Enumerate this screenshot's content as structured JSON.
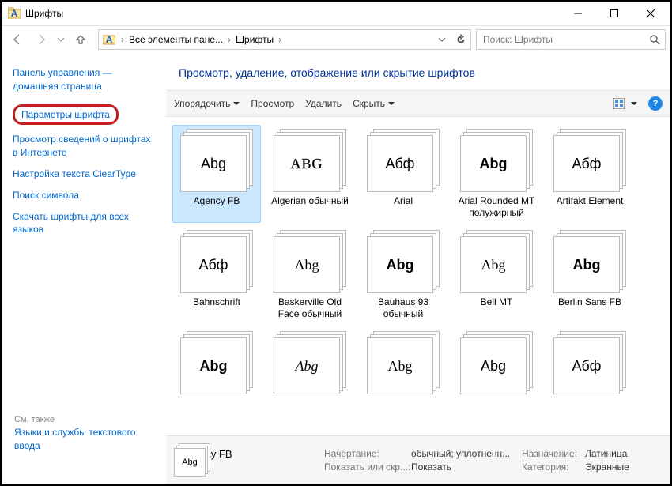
{
  "titlebar": {
    "title": "Шрифты"
  },
  "nav": {
    "crumbs": [
      "Все элементы пане...",
      "Шрифты"
    ]
  },
  "search": {
    "placeholder": "Поиск: Шрифты"
  },
  "sidebar": {
    "home": "Панель управления — домашняя страница",
    "highlight": "Параметры шрифта",
    "links": [
      "Просмотр сведений о шрифтах в Интернете",
      "Настройка текста ClearType",
      "Поиск символа",
      "Скачать шрифты для всех языков"
    ],
    "also_label": "См. также",
    "also_link": "Языки и службы текстового ввода"
  },
  "main": {
    "header": "Просмотр, удаление, отображение или скрытие шрифтов",
    "toolbar": {
      "organize": "Упорядочить",
      "preview": "Просмотр",
      "delete": "Удалить",
      "hide": "Скрыть"
    }
  },
  "fonts": [
    {
      "name": "Agency FB",
      "sample": "Abg",
      "style": "normal",
      "family": "'Agency FB',sans-serif",
      "weight": "normal",
      "selected": true
    },
    {
      "name": "Algerian обычный",
      "sample": "ABG",
      "style": "normal",
      "family": "'Algerian',serif",
      "weight": "normal",
      "outline": true
    },
    {
      "name": "Arial",
      "sample": "Абф",
      "style": "normal",
      "family": "Arial,sans-serif",
      "weight": "normal"
    },
    {
      "name": "Arial Rounded MT полужирный",
      "sample": "Abg",
      "style": "normal",
      "family": "'Arial Rounded MT Bold',Arial,sans-serif",
      "weight": "bold"
    },
    {
      "name": "Artifakt Element",
      "sample": "Абф",
      "style": "normal",
      "family": "Arial,sans-serif",
      "weight": "normal"
    },
    {
      "name": "Bahnschrift",
      "sample": "Абф",
      "style": "normal",
      "family": "Bahnschrift,Arial,sans-serif",
      "weight": "normal"
    },
    {
      "name": "Baskerville Old Face обычный",
      "sample": "Abg",
      "style": "normal",
      "family": "'Baskerville Old Face',serif",
      "weight": "normal"
    },
    {
      "name": "Bauhaus 93 обычный",
      "sample": "Abg",
      "style": "normal",
      "family": "'Bauhaus 93',sans-serif",
      "weight": "bold"
    },
    {
      "name": "Bell MT",
      "sample": "Abg",
      "style": "normal",
      "family": "'Bell MT',serif",
      "weight": "normal"
    },
    {
      "name": "Berlin Sans FB",
      "sample": "Abg",
      "style": "normal",
      "family": "'Berlin Sans FB',sans-serif",
      "weight": "bold"
    },
    {
      "name": "",
      "sample": "Abg",
      "style": "normal",
      "family": "Arial Black,sans-serif",
      "weight": "900"
    },
    {
      "name": "",
      "sample": "Abg",
      "style": "italic",
      "family": "'Brush Script MT',cursive",
      "weight": "normal"
    },
    {
      "name": "",
      "sample": "Abg",
      "style": "normal",
      "family": "Georgia,serif",
      "weight": "normal"
    },
    {
      "name": "",
      "sample": "Abg",
      "style": "normal",
      "family": "Impact,sans-serif",
      "weight": "normal",
      "stretch": "condensed"
    },
    {
      "name": "",
      "sample": "Абф",
      "style": "normal",
      "family": "Arial,sans-serif",
      "weight": "normal"
    }
  ],
  "details": {
    "name": "Agency FB",
    "thumb_sample": "Abg",
    "style_label": "Начертание:",
    "style_value": "обычный; уплотненн...",
    "show_label": "Показать или скр...:",
    "show_value": "Показать",
    "designed_label": "Назначение:",
    "designed_value": "Латиница",
    "category_label": "Категория:",
    "category_value": "Экранные"
  }
}
